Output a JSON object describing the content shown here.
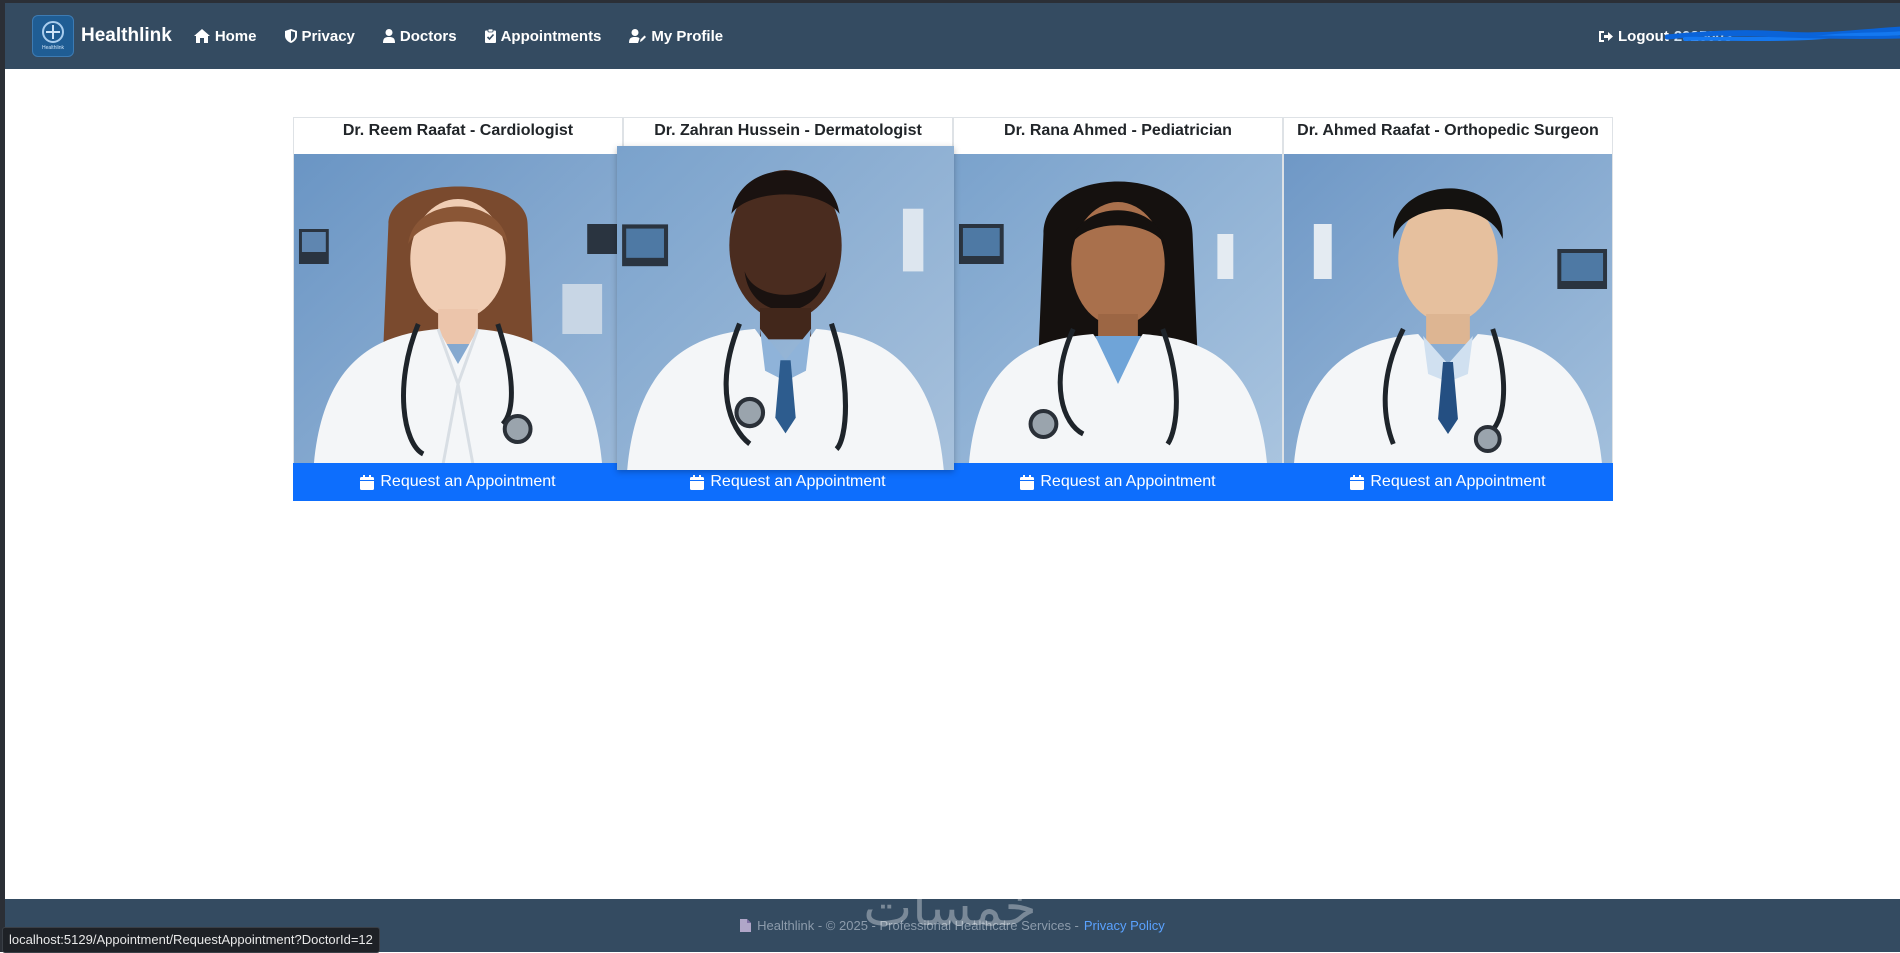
{
  "navbar": {
    "brand": "Healthlink",
    "brand_logo_text": "Healthlink",
    "items": [
      {
        "label": "Home",
        "icon": "home-icon"
      },
      {
        "label": "Privacy",
        "icon": "shield-icon"
      },
      {
        "label": "Doctors",
        "icon": "user-icon"
      },
      {
        "label": "Appointments",
        "icon": "clipboard-check-icon"
      },
      {
        "label": "My Profile",
        "icon": "user-edit-icon"
      }
    ],
    "logout_label": "Logout",
    "logout_user": "2025003"
  },
  "doctors": [
    {
      "title": "Dr. Reem Raafat - Cardiologist",
      "button": "Request an Appointment"
    },
    {
      "title": "Dr. Zahran Hussein - Dermatologist",
      "button": "Request an Appointment"
    },
    {
      "title": "Dr. Rana Ahmed - Pediatrician",
      "button": "Request an Appointment"
    },
    {
      "title": "Dr. Ahmed Raafat - Orthopedic Surgeon",
      "button": "Request an Appointment"
    }
  ],
  "footer": {
    "text": "Healthlink - © 2025 - Professional Healthcare Services -",
    "link": "Privacy Policy"
  },
  "watermark": "خمسات",
  "status_url": "localhost:5129/Appointment/RequestAppointment?DoctorId=12",
  "colors": {
    "navbar": "#344b61",
    "primary_button": "#0d6efd",
    "footer_link": "#5aa2ff"
  }
}
